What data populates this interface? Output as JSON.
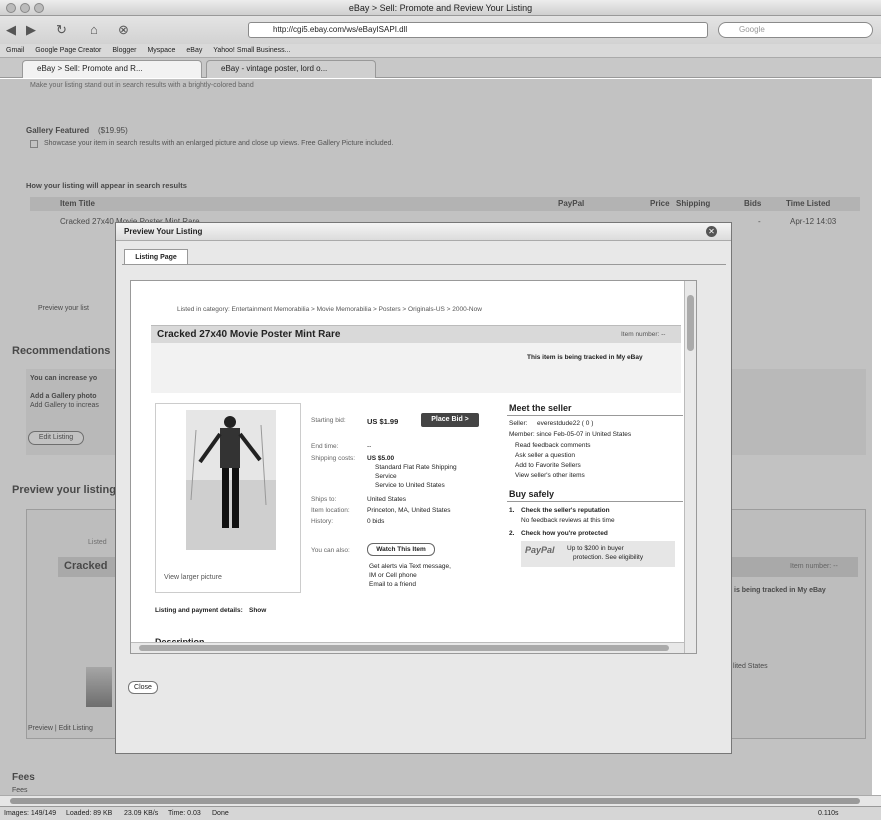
{
  "window": {
    "title": "eBay > Sell: Promote and Review Your Listing"
  },
  "toolbar": {
    "url": "http://cgi5.ebay.com/ws/eBayISAPI.dll",
    "search_placeholder": "Google"
  },
  "bookmarks": [
    "Gmail",
    "Google Page Creator",
    "Blogger",
    "Myspace",
    "eBay",
    "Yahoo! Small Business..."
  ],
  "tabs": [
    "eBay > Sell: Promote and R...",
    "eBay - vintage poster, lord o..."
  ],
  "page": {
    "bold_note": "Make your listing stand out in search results with a brightly-colored band",
    "gallery_featured_title": "Gallery Featured",
    "gallery_featured_price": "($19.95)",
    "gallery_featured_desc": "Showcase your item in search results with an enlarged picture and close up views. Free Gallery Picture included.",
    "search_results_title": "How your listing will appear in search results",
    "table_headers": {
      "item_title": "Item Title",
      "paypal": "PayPal",
      "price": "Price",
      "shipping": "Shipping",
      "bids": "Bids",
      "time_listed": "Time Listed"
    },
    "row": {
      "title": "Cracked 27x40 Movie Poster Mint Rare",
      "bids": "-",
      "time_listed": "Apr-12 14:03"
    },
    "preview_link": "Preview your list",
    "recommendations_title": "Recommendations",
    "rec_line1": "You can increase yo",
    "rec_line2": "Add a Gallery photo",
    "rec_line3": "Add Gallery to increas",
    "edit_listing": "Edit Listing",
    "preview_title": "Preview your listing",
    "bg_listed": "Listed",
    "bg_cracked": "Cracked",
    "bg_item_number": "Item number: --",
    "bg_tracked": "is being tracked in My eBay",
    "bg_states": "lited States",
    "bg_preview_edit": "Preview | Edit Listing",
    "fees_title": "Fees",
    "fees_sub": "Fees"
  },
  "modal": {
    "title": "Preview Your Listing",
    "tab": "Listing Page",
    "close_button": "Close",
    "breadcrumb": "Listed in category: Entertainment Memorabilia > Movie Memorabilia > Posters > Originals-US > 2000-Now",
    "item_title": "Cracked 27x40 Movie Poster Mint Rare",
    "item_number": "Item number: --",
    "tracked": "This item is being tracked in My eBay",
    "starting_bid_label": "Starting bid:",
    "starting_bid": "US $1.99",
    "place_bid": "Place Bid >",
    "end_time_label": "End time:",
    "end_time": "--",
    "shipping_label": "Shipping costs:",
    "shipping_cost": "US $5.00",
    "shipping_l1": "Standard Flat Rate Shipping",
    "shipping_l2": "Service",
    "shipping_l3": "Service to United States",
    "ships_to_label": "Ships to:",
    "ships_to": "United States",
    "location_label": "Item location:",
    "location": "Princeton, MA, United States",
    "history_label": "History:",
    "history": "0 bids",
    "you_can_also": "You can also:",
    "watch_button": "Watch This Item",
    "alerts1": "Get alerts via Text message,",
    "alerts2": "IM or Cell phone",
    "email_friend": "Email to a friend",
    "view_larger": "View larger picture",
    "payment_label": "Listing and payment details:",
    "payment_show": "Show",
    "description": "Description",
    "meet_seller": "Meet the seller",
    "seller_label": "Seller:",
    "seller": "everestdude22 ( 0 )",
    "member_since": "Member: since Feb-05-07 in United States",
    "seller_links": [
      "Read feedback comments",
      "Ask seller a question",
      "Add to Favorite Sellers",
      "View seller's other items"
    ],
    "buy_safely": "Buy safely",
    "check1_title": "Check the seller's reputation",
    "check1_desc": "No feedback reviews at this time",
    "check2_title": "Check how you're protected",
    "paypal_logo": "PayPal",
    "protect1": "Up to $200 in buyer",
    "protect2": "protection. See eligibility"
  },
  "status": {
    "images": "Images: 149/149",
    "loaded": "Loaded: 89 KB",
    "speed": "23.09 KB/s",
    "time": "Time: 0.03",
    "done": "Done",
    "zoom": "0.110s"
  }
}
